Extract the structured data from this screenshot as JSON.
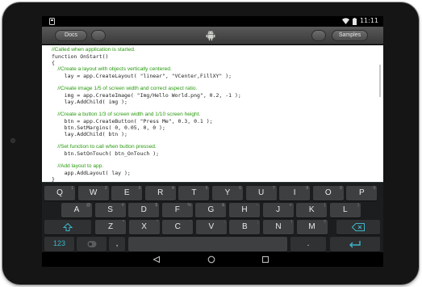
{
  "status_bar": {
    "time": "11:11",
    "icons": [
      "app-notification-icon",
      "wifi-icon",
      "battery-icon"
    ]
  },
  "action_bar": {
    "docs_label": "Docs",
    "samples_label": "Samples",
    "logo_icon": "android-logo-icon"
  },
  "editor": {
    "lines": [
      {
        "text": "//Called when application is started.",
        "type": "comment"
      },
      {
        "text": "function OnStart()",
        "type": "code"
      },
      {
        "text": "{",
        "type": "code"
      },
      {
        "text": "    //Create a layout with objects vertically centered.",
        "type": "comment"
      },
      {
        "text": "    lay = app.CreateLayout( \"linear\", \"VCenter,FillXY\" );",
        "type": "code"
      },
      {
        "text": "",
        "type": "code"
      },
      {
        "text": "    //Create image 1/5 of screen width and correct aspect ratio.",
        "type": "comment"
      },
      {
        "text": "    img = app.CreateImage( \"Img/Hello World.png\", 0.2, -1 );",
        "type": "code"
      },
      {
        "text": "    lay.AddChild( img );",
        "type": "code"
      },
      {
        "text": "",
        "type": "code"
      },
      {
        "text": "    //Create a button 1/3 of screen width and 1/10 screen height.",
        "type": "comment"
      },
      {
        "text": "    btn = app.CreateButton( \"Press Me\", 0.3, 0.1 );",
        "type": "code"
      },
      {
        "text": "    btn.SetMargins( 0, 0.05, 0, 0 );",
        "type": "code"
      },
      {
        "text": "    lay.AddChild( btn );",
        "type": "code"
      },
      {
        "text": "",
        "type": "code"
      },
      {
        "text": "    //Set function to call when button pressed.",
        "type": "comment"
      },
      {
        "text": "    btn.SetOnTouch( btn_OnTouch );",
        "type": "code"
      },
      {
        "text": "",
        "type": "code"
      },
      {
        "text": "    //Add layout to app.",
        "type": "comment"
      },
      {
        "text": "    app.AddLayout( lay );",
        "type": "code"
      },
      {
        "text": "}",
        "type": "code"
      }
    ]
  },
  "keyboard": {
    "row1": [
      {
        "label": "Q",
        "hint": "1"
      },
      {
        "label": "W",
        "hint": "2"
      },
      {
        "label": "E",
        "hint": "3"
      },
      {
        "label": "R",
        "hint": "4"
      },
      {
        "label": "T",
        "hint": "5"
      },
      {
        "label": "Y",
        "hint": "6"
      },
      {
        "label": "U",
        "hint": "7"
      },
      {
        "label": "I",
        "hint": "8"
      },
      {
        "label": "O",
        "hint": "9"
      },
      {
        "label": "P",
        "hint": "0"
      }
    ],
    "row2": [
      {
        "label": "A",
        "hint": "@"
      },
      {
        "label": "S",
        "hint": "#"
      },
      {
        "label": "D",
        "hint": "$"
      },
      {
        "label": "F",
        "hint": "%"
      },
      {
        "label": "G",
        "hint": "&"
      },
      {
        "label": "H",
        "hint": "-"
      },
      {
        "label": "J",
        "hint": "+"
      },
      {
        "label": "K",
        "hint": "("
      },
      {
        "label": "L",
        "hint": ")"
      }
    ],
    "row3": [
      {
        "label": "Z",
        "hint": "*"
      },
      {
        "label": "X",
        "hint": "\""
      },
      {
        "label": "C",
        "hint": "'"
      },
      {
        "label": "V",
        "hint": ":"
      },
      {
        "label": "B",
        "hint": ";"
      },
      {
        "label": "N",
        "hint": "!"
      },
      {
        "label": "M",
        "hint": "?"
      }
    ],
    "row4": {
      "symbols_label": "123",
      "comma_label": ",",
      "period_label": "."
    },
    "accent_color": "#3eb4c8"
  },
  "nav_bar": {
    "icons": [
      "back-icon",
      "home-icon",
      "recent-apps-icon"
    ]
  }
}
